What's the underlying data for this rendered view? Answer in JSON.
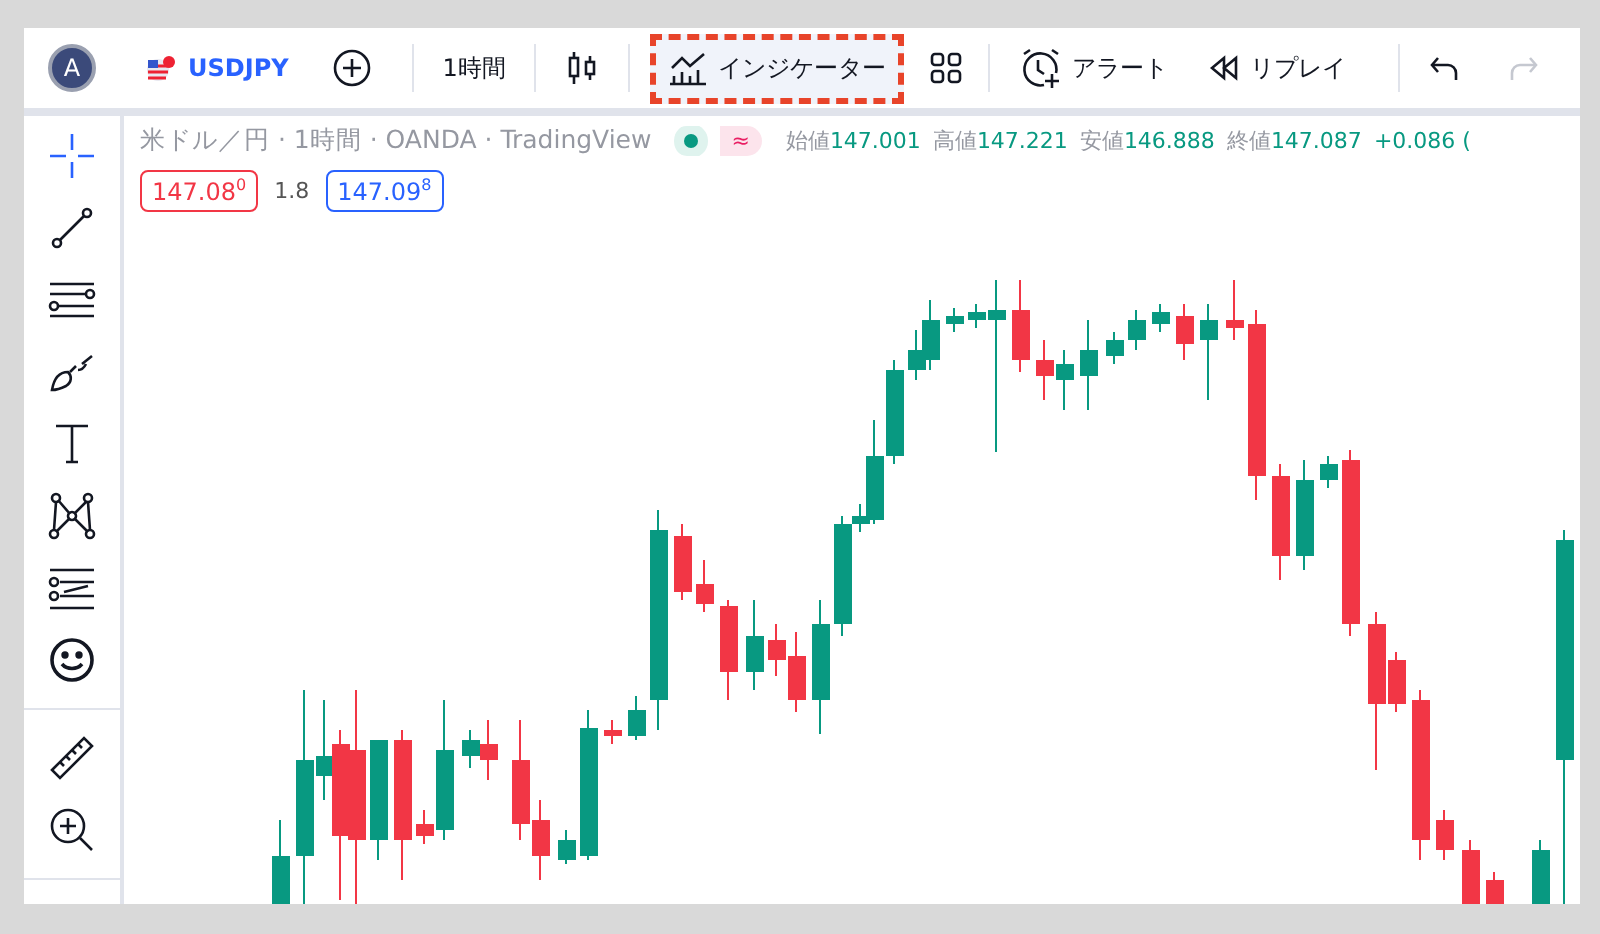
{
  "toolbar": {
    "avatar": "A",
    "symbol": "USDJPY",
    "interval": "1時間",
    "indicators": {
      "label": "インジケーター",
      "highlighted": true
    },
    "alert": "アラート",
    "replay": "リプレイ",
    "undo": {
      "disabled": false
    },
    "redo": {
      "disabled": true
    }
  },
  "drawing_tools": [
    {
      "kind": "crosshair",
      "selected": true
    },
    {
      "kind": "trendline",
      "selected": false
    },
    {
      "kind": "fib",
      "selected": false
    },
    {
      "kind": "brush",
      "selected": false
    },
    {
      "kind": "text",
      "selected": false
    },
    {
      "kind": "pattern",
      "selected": false
    },
    {
      "kind": "forecast",
      "selected": false
    },
    {
      "kind": "emoji",
      "selected": false
    }
  ],
  "measure_tools": [
    {
      "kind": "ruler",
      "selected": false
    },
    {
      "kind": "zoom",
      "selected": false
    }
  ],
  "legend": {
    "title": "米ドル／円 · 1時間 · OANDA · TradingView",
    "status": "≈",
    "ohlc": [
      {
        "label": "始値",
        "value": "147.001"
      },
      {
        "label": "高値",
        "value": "147.221"
      },
      {
        "label": "安値",
        "value": "146.888"
      },
      {
        "label": "終値",
        "value": "147.087"
      }
    ],
    "change": "+0.086 (",
    "sell": "147.08$^{0}$",
    "spread": "1.8",
    "buy": "147.09$^{8}$"
  }
}
